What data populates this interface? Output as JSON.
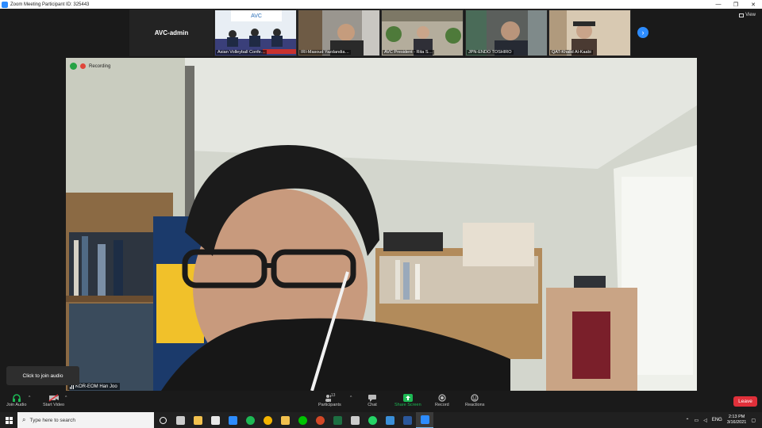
{
  "window": {
    "title": "Zoom Meeting Participant ID: 325443",
    "controls": [
      "—",
      "❐",
      "✕"
    ]
  },
  "strip": {
    "admin_name": "AVC-admin",
    "thumbnails": [
      {
        "label": "Asian Volleyball Confe…",
        "bg": "#dfe7f0"
      },
      {
        "label": "IRI-Masoud Yazdandia…",
        "bg": "#8d8b85"
      },
      {
        "label": "AVC President - Rita S…",
        "bg": "#a9a596"
      },
      {
        "label": "JPN-ENDO TOSHIRO",
        "bg": "#6d6c6a"
      },
      {
        "label": "QAT-Khalid Al-Kaabi",
        "bg": "#c8b9a4"
      }
    ],
    "view_label": "View",
    "next_icon": "›"
  },
  "main": {
    "recording_label": "Recording",
    "speaker": "KOR-EOM Han Joo"
  },
  "tooltip": "Click to join audio",
  "toolbar": {
    "join_audio": "Join Audio",
    "start_video": "Start Video",
    "participants": "Participants",
    "participants_count": "13",
    "chat": "Chat",
    "share_screen": "Share Screen",
    "record": "Record",
    "reactions": "Reactions",
    "leave": "Leave",
    "caret": "^"
  },
  "taskbar": {
    "search_placeholder": "Type here to search",
    "lang": "ENG",
    "time": "2:13 PM",
    "date": "3/16/2021",
    "apps": [
      {
        "name": "cortana-icon",
        "color": "#ffffff"
      },
      {
        "name": "task-view-icon",
        "color": "#cccccc"
      },
      {
        "name": "file-explorer-icon",
        "color": "#f2c14e"
      },
      {
        "name": "store-icon",
        "color": "#e8e8e8"
      },
      {
        "name": "mail-icon",
        "color": "#2d8cff"
      },
      {
        "name": "spotify-icon",
        "color": "#1db954"
      },
      {
        "name": "chrome-icon",
        "color": "#f4b400"
      },
      {
        "name": "folder-icon",
        "color": "#f2c14e"
      },
      {
        "name": "line-icon",
        "color": "#00c300"
      },
      {
        "name": "powerpoint-icon",
        "color": "#d24726"
      },
      {
        "name": "excel-icon",
        "color": "#1d6f42"
      },
      {
        "name": "settings-icon",
        "color": "#cccccc"
      },
      {
        "name": "whatsapp-icon",
        "color": "#25d366"
      },
      {
        "name": "photos-icon",
        "color": "#3a8fd8"
      },
      {
        "name": "word-icon",
        "color": "#2b579a"
      },
      {
        "name": "zoom-icon",
        "color": "#2d8cff"
      }
    ]
  }
}
